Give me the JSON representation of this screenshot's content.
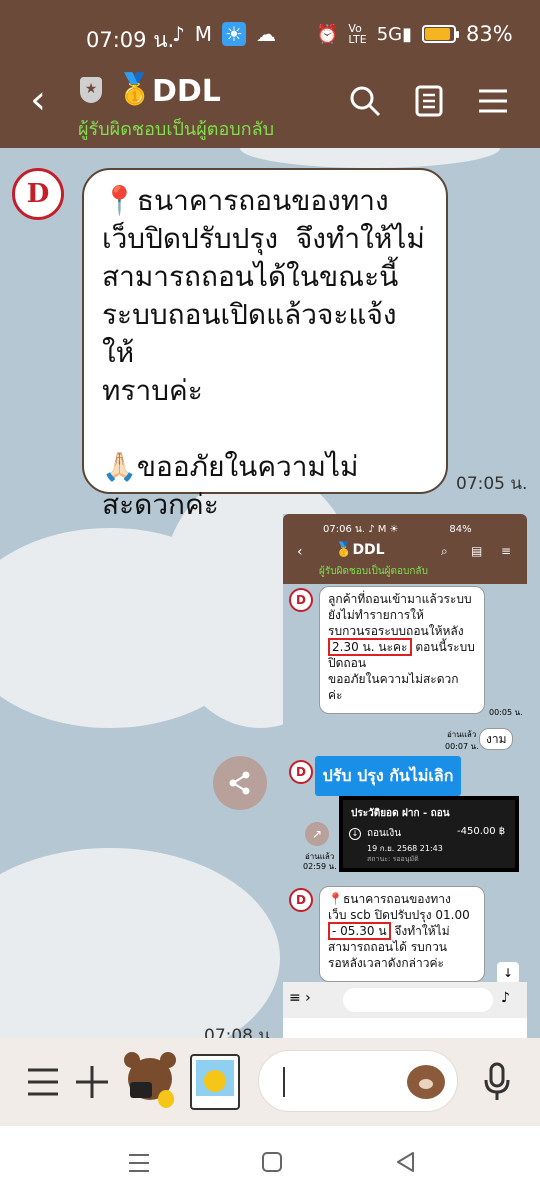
{
  "status_bar": {
    "time": "07:09 น.",
    "icons_left": [
      "tiktok-icon",
      "gmail-icon",
      "weather-icon",
      "cloud-icon"
    ],
    "icons_right": [
      "alarm-icon",
      "volte-icon",
      "5g-signal-icon"
    ],
    "battery_percent": "83%",
    "battery_level": 0.83,
    "battery_color": "#f4b521"
  },
  "header": {
    "title": "DDL",
    "subtitle": "ผู้รับผิดชอบเป็นผู้ตอบกลับ",
    "background": "#6b4a3a",
    "subtitle_color": "#7ee04a"
  },
  "messages": [
    {
      "sender_avatar": "D",
      "text": "📍ธนาคารถอนของทาง\nเว็บปิดปรับปรุง  จึงทำให้ไม่\nสามารถถอนได้ในขณะนี้\nระบบถอนเปิดแล้วจะแจ้งให้\nทราบค่ะ\n\n🙏🏻ขออภัยในความไม่\nสะดวกค่ะ",
      "time": "07:05 น."
    },
    {
      "type": "image",
      "time": "07:08 น."
    }
  ],
  "embedded": {
    "status_time": "07:06 น.",
    "battery": "84%",
    "title": "DDL",
    "subtitle": "ผู้รับผิดชอบเป็นผู้ตอบกลับ",
    "msg1_line1": "ลูกค้าที่ถอนเข้ามาแล้วระบบ",
    "msg1_line2": "ยังไม่ทำรายการให้",
    "msg1_line3": "รบกวนรอระบบถอนให้หลัง",
    "msg1_highlight": "2.30 น. นะคะ",
    "msg1_after": "ตอนนี้ระบบ",
    "msg1_line5": "ปิดถอน",
    "msg1_line6": "ขออภัยในความไม่สะดวก",
    "msg1_line7": "ค่ะ",
    "msg1_time": "00:05 น.",
    "read_label": "อ่านแล้ว",
    "reply_time": "00:07 น.",
    "reply_text": "งาม",
    "banner_text": "ปรับ ปรุง กันไม่เลิก",
    "card_title": "ประวัติยอด ฝาก - ถอน",
    "card_item": "ถอนเงิน",
    "card_amount": "-450.00 ฿",
    "card_date": "19 ก.ย. 2568 21:43",
    "card_status": "สถานะ: รออนุมัติ",
    "read_label2": "อ่านแล้ว",
    "share_time": "02:59 น.",
    "msg2_line1": "📍ธนาคารถอนของทาง",
    "msg2_line2": "เว็บ scb ปิดปรับปรุง 01.00",
    "msg2_highlight": "- 05.30 น",
    "msg2_after": "จึงทำให้ไม่",
    "msg2_line4": "สามารถถอนได้ รบกวน",
    "msg2_line5": "รอหลังเวลาดังกล่าวค่ะ"
  },
  "input_bar": {
    "icons": [
      "menu-icon",
      "plus-icon",
      "bear-sticker-icon",
      "photo-sticker-icon",
      "emoji-bear-icon",
      "mic-icon"
    ]
  }
}
